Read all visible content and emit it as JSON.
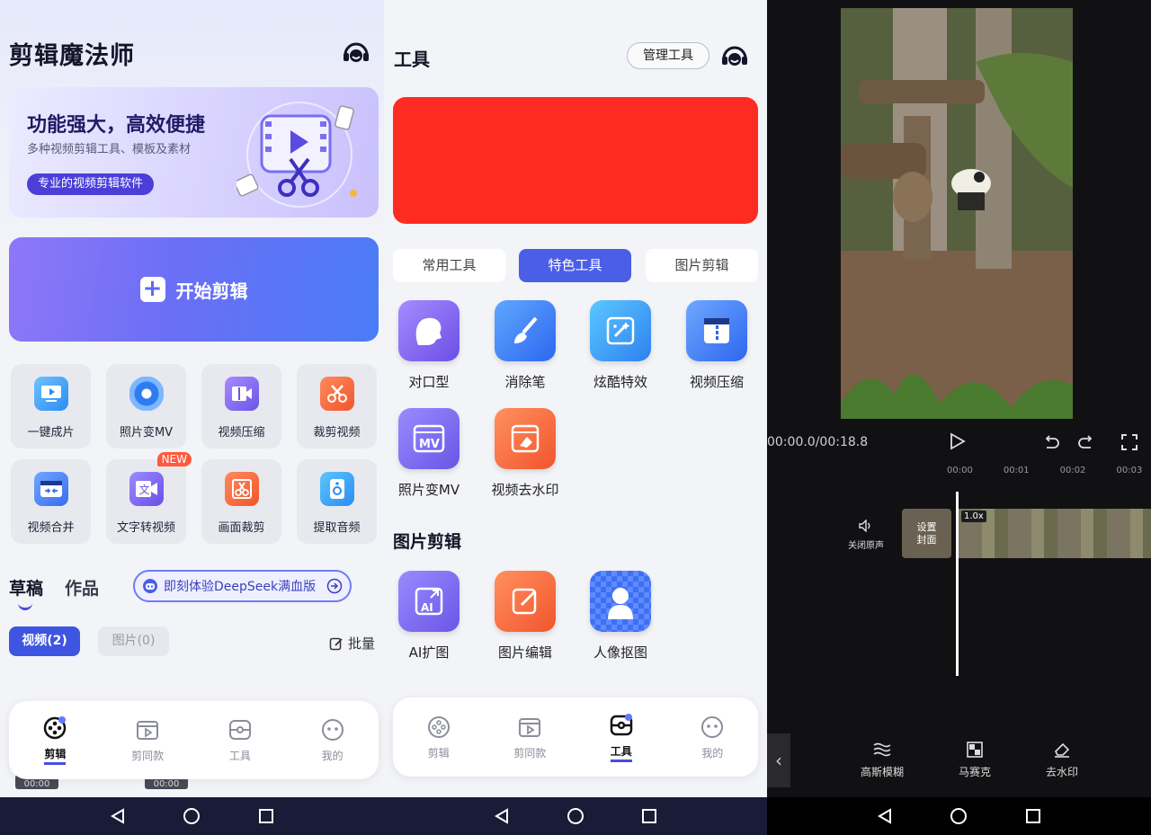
{
  "colors": {
    "accent": "#4a5ee6",
    "red_banner": "#fd2b22",
    "editor_bg": "#111114",
    "new_tag": "#ff5a3c"
  },
  "panel1": {
    "app_title": "剪辑魔法师",
    "banner": {
      "headline": "功能强大，高效便捷",
      "subtitle": "多种视频剪辑工具、模板及素材",
      "button": "专业的视频剪辑软件"
    },
    "start_button": "开始剪辑",
    "tools": [
      {
        "label": "一键成片",
        "icon": "play-screen-icon"
      },
      {
        "label": "照片变MV",
        "icon": "disc-icon"
      },
      {
        "label": "视频压缩",
        "icon": "zip-video-icon"
      },
      {
        "label": "裁剪视频",
        "icon": "scissors-icon"
      },
      {
        "label": "视频合并",
        "icon": "merge-icon"
      },
      {
        "label": "文字转视频",
        "icon": "text-video-icon",
        "badge": "NEW"
      },
      {
        "label": "画面裁剪",
        "icon": "crop-icon"
      },
      {
        "label": "提取音频",
        "icon": "speaker-icon"
      }
    ],
    "tabs": {
      "drafts": "草稿",
      "works": "作品"
    },
    "deepseek": "即刻体验DeepSeek满血版",
    "filters": {
      "video": "视频(2)",
      "image": "图片(0)"
    },
    "batch": "批量",
    "bottom_nav": [
      "剪辑",
      "剪同款",
      "工具",
      "我的"
    ],
    "thumb_time": "00:00"
  },
  "panel2": {
    "title": "工具",
    "manage": "管理工具",
    "segments": [
      "常用工具",
      "特色工具",
      "图片剪辑"
    ],
    "tools": [
      {
        "label": "对口型",
        "icon": "lip-sync-icon"
      },
      {
        "label": "消除笔",
        "icon": "eraser-brush-icon"
      },
      {
        "label": "炫酷特效",
        "icon": "sparkle-icon"
      },
      {
        "label": "视频压缩",
        "icon": "compress-icon"
      },
      {
        "label": "照片变MV",
        "icon": "mv-icon"
      },
      {
        "label": "视频去水印",
        "icon": "watermark-icon"
      }
    ],
    "image_section": "图片剪辑",
    "image_tools": [
      {
        "label": "AI扩图",
        "icon": "ai-expand-icon"
      },
      {
        "label": "图片编辑",
        "icon": "image-edit-icon"
      },
      {
        "label": "人像抠图",
        "icon": "portrait-icon"
      }
    ],
    "bottom_nav": [
      "剪辑",
      "剪同款",
      "工具",
      "我的"
    ]
  },
  "panel3": {
    "time": "00:00.0/00:18.8",
    "ticks": [
      "00:00",
      "00:01",
      "00:02",
      "00:03"
    ],
    "mute_label": "关闭原声",
    "cover_label": "设置\n封面",
    "speed": "1.0x",
    "toolbar": [
      {
        "label": "高斯模糊",
        "icon": "blur-icon"
      },
      {
        "label": "马赛克",
        "icon": "mosaic-icon"
      },
      {
        "label": "去水印",
        "icon": "eraser-icon"
      }
    ]
  }
}
